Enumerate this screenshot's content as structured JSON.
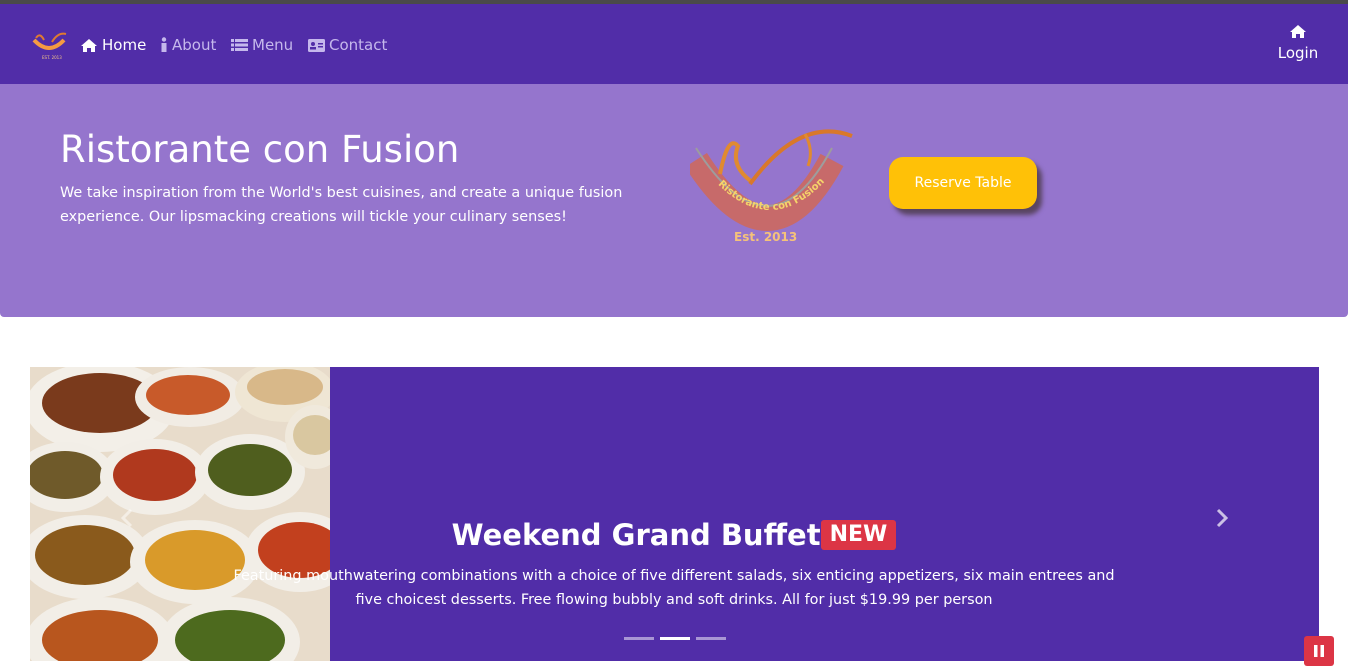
{
  "nav": {
    "items": [
      {
        "label": "Home",
        "icon": "home-icon",
        "active": true
      },
      {
        "label": "About",
        "icon": "info-icon",
        "active": false
      },
      {
        "label": "Menu",
        "icon": "list-icon",
        "active": false
      },
      {
        "label": "Contact",
        "icon": "address-card-icon",
        "active": false
      }
    ],
    "login_label": "Login",
    "login_icon": "home-icon"
  },
  "hero": {
    "title": "Ristorante con Fusion",
    "description": "We take inspiration from the World's best cuisines, and create a unique fusion experience. Our lipsmacking creations will tickle your culinary senses!",
    "logo_text": "Ristorante con Fusion",
    "logo_est": "Est. 2013",
    "reserve_label": "Reserve Table"
  },
  "carousel": {
    "slide_title": "Weekend Grand Buffet",
    "badge": "NEW",
    "slide_text": "Featuring mouthwatering combinations with a choice of five different salads, six enticing appetizers, six main entrees and five choicest desserts. Free flowing bubbly and soft drinks. All for just $19.99 per person",
    "indicator_count": 3,
    "active_indicator": 1
  },
  "colors": {
    "navbar": "#512da8",
    "jumbotron": "#9575cd",
    "reserve_button": "#ffc107",
    "badge": "#dc3545",
    "carousel_bg": "#512da8"
  }
}
